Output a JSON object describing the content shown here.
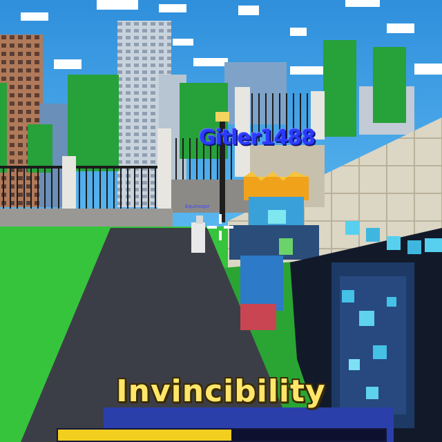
{
  "hud": {
    "player_name": "Gitler1488",
    "small_name": "Equinoqor",
    "powerup_label": "Invincibility",
    "powerup_progress": 0.53
  },
  "colors": {
    "player_name": "#2a3bff",
    "powerup_label": "#ffe66a",
    "progress_fill": "#f2cf1f",
    "progress_track": "#0e1030"
  },
  "icons": [
    "crosshair-icon"
  ]
}
